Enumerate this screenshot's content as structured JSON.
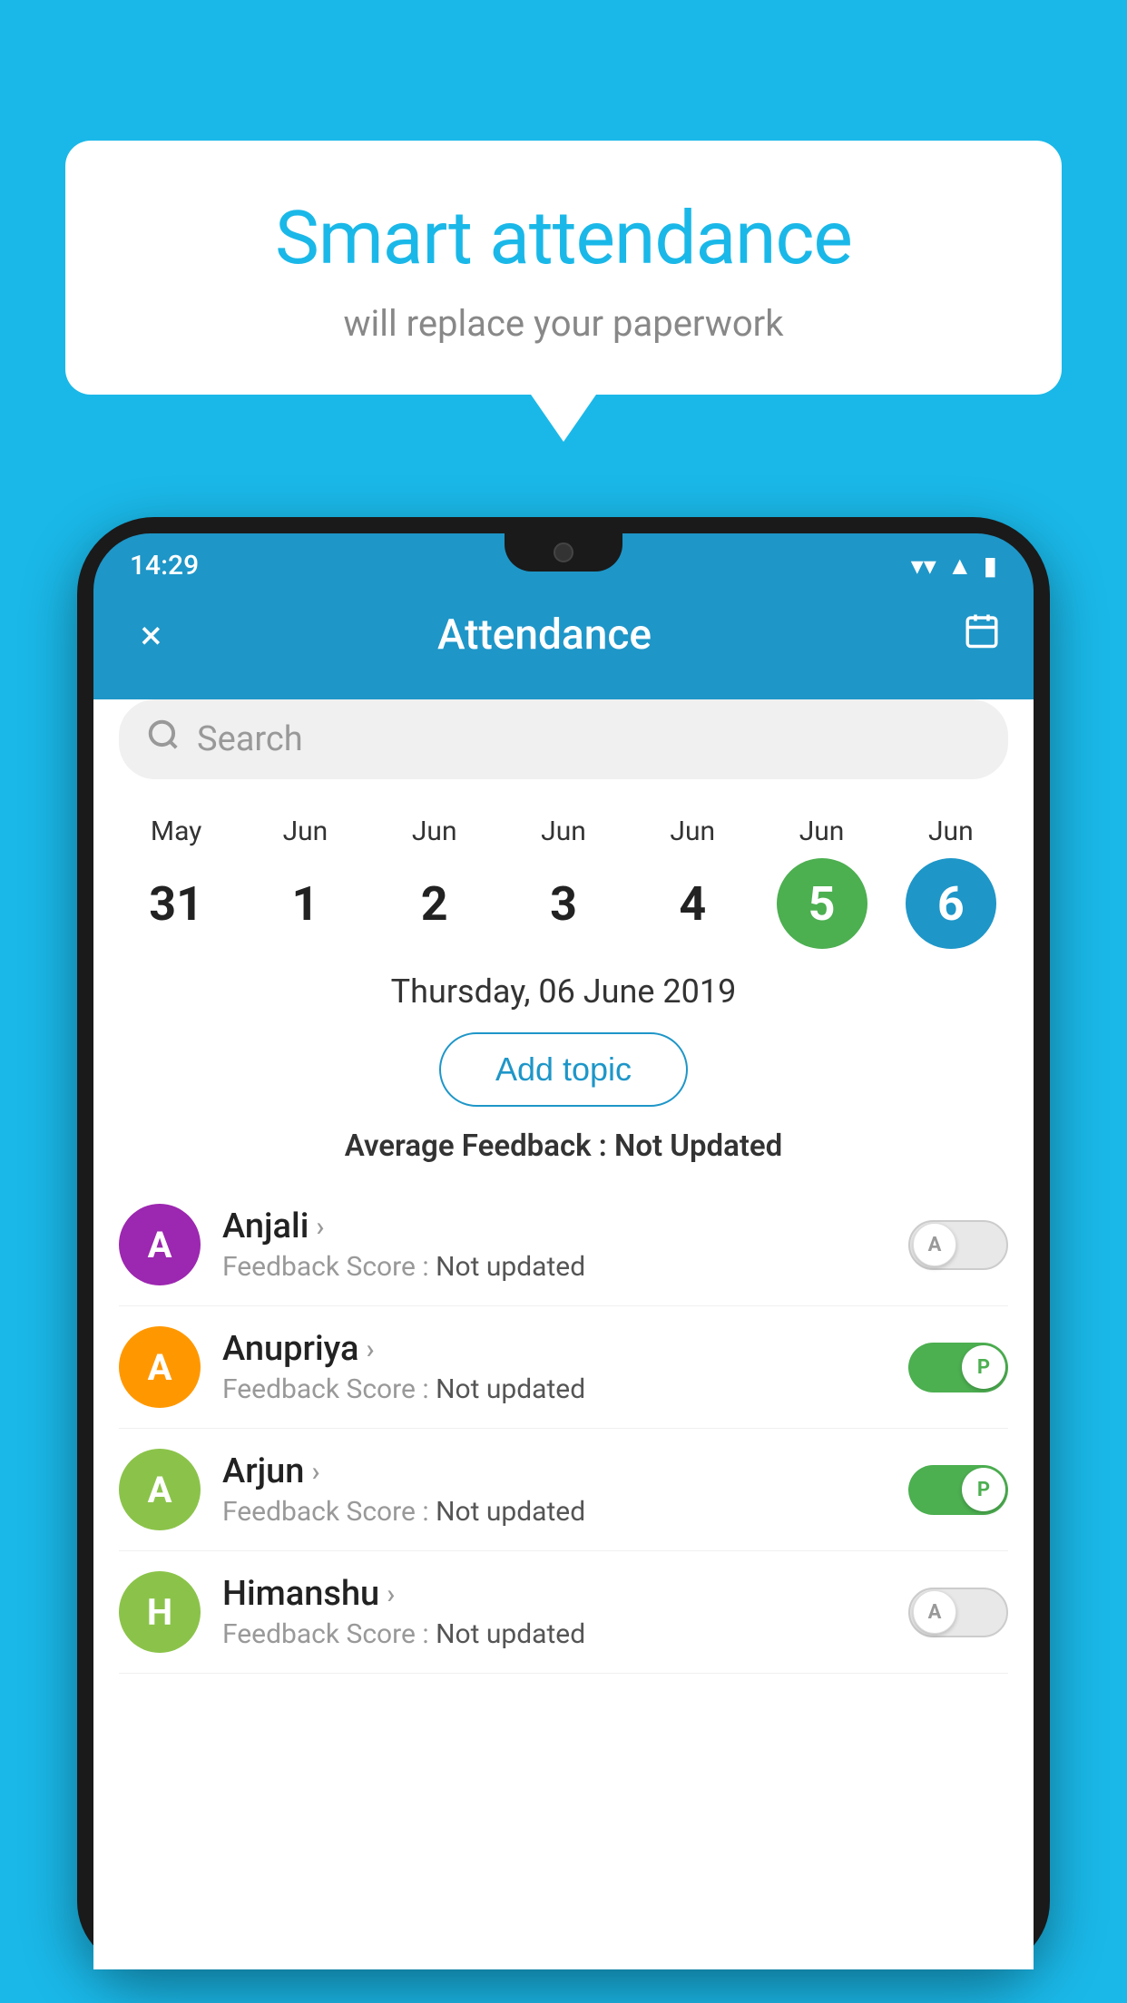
{
  "background_color": "#1ab8e8",
  "bubble": {
    "title": "Smart attendance",
    "subtitle": "will replace your paperwork"
  },
  "status_bar": {
    "time": "14:29",
    "icons": [
      "wifi",
      "signal",
      "battery"
    ]
  },
  "app_bar": {
    "title": "Attendance",
    "close_label": "×",
    "calendar_icon": "🗓"
  },
  "search": {
    "placeholder": "Search"
  },
  "calendar": {
    "days": [
      {
        "month": "May",
        "date": "31",
        "style": "normal"
      },
      {
        "month": "Jun",
        "date": "1",
        "style": "normal"
      },
      {
        "month": "Jun",
        "date": "2",
        "style": "normal"
      },
      {
        "month": "Jun",
        "date": "3",
        "style": "normal"
      },
      {
        "month": "Jun",
        "date": "4",
        "style": "normal"
      },
      {
        "month": "Jun",
        "date": "5",
        "style": "today"
      },
      {
        "month": "Jun",
        "date": "6",
        "style": "selected"
      }
    ],
    "selected_date": "Thursday, 06 June 2019"
  },
  "add_topic_label": "Add topic",
  "avg_feedback_label": "Average Feedback :",
  "avg_feedback_value": "Not Updated",
  "students": [
    {
      "name": "Anjali",
      "avatar_letter": "A",
      "avatar_color": "#9c27b0",
      "feedback_label": "Feedback Score :",
      "feedback_value": "Not updated",
      "toggle": "off",
      "toggle_letter": "A"
    },
    {
      "name": "Anupriya",
      "avatar_letter": "A",
      "avatar_color": "#ff9800",
      "feedback_label": "Feedback Score :",
      "feedback_value": "Not updated",
      "toggle": "on",
      "toggle_letter": "P"
    },
    {
      "name": "Arjun",
      "avatar_letter": "A",
      "avatar_color": "#8bc34a",
      "feedback_label": "Feedback Score :",
      "feedback_value": "Not updated",
      "toggle": "on",
      "toggle_letter": "P"
    },
    {
      "name": "Himanshu",
      "avatar_letter": "H",
      "avatar_color": "#8bc34a",
      "feedback_label": "Feedback Score :",
      "feedback_value": "Not updated",
      "toggle": "off",
      "toggle_letter": "A"
    }
  ]
}
